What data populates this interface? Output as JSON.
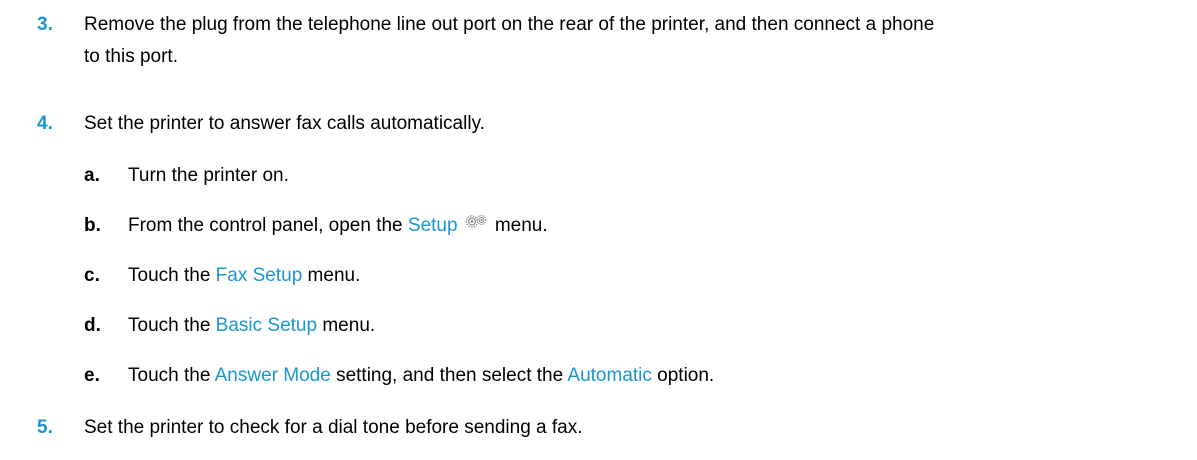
{
  "steps": [
    {
      "number": "3.",
      "line1": "Remove the plug from the telephone line out port on the rear of the printer, and then connect a phone",
      "line2": "to this port."
    },
    {
      "number": "4.",
      "text": "Set the printer to answer fax calls automatically.",
      "substeps": [
        {
          "letter": "a.",
          "pre": "Turn the printer on."
        },
        {
          "letter": "b.",
          "pre": "From the control panel, open the ",
          "link": "Setup",
          "icon": "gear-icon",
          "post": " menu."
        },
        {
          "letter": "c.",
          "pre": "Touch the ",
          "link": "Fax Setup",
          "post": " menu."
        },
        {
          "letter": "d.",
          "pre": "Touch the ",
          "link": "Basic Setup",
          "post": " menu."
        },
        {
          "letter": "e.",
          "pre": "Touch the ",
          "link": "Answer Mode",
          "mid": " setting, and then select the ",
          "link2": "Automatic",
          "post": " option."
        }
      ]
    },
    {
      "number": "5.",
      "text": "Set the printer to check for a dial tone before sending a fax."
    }
  ],
  "colors": {
    "accent": "#1a96d4",
    "text": "#000000"
  }
}
